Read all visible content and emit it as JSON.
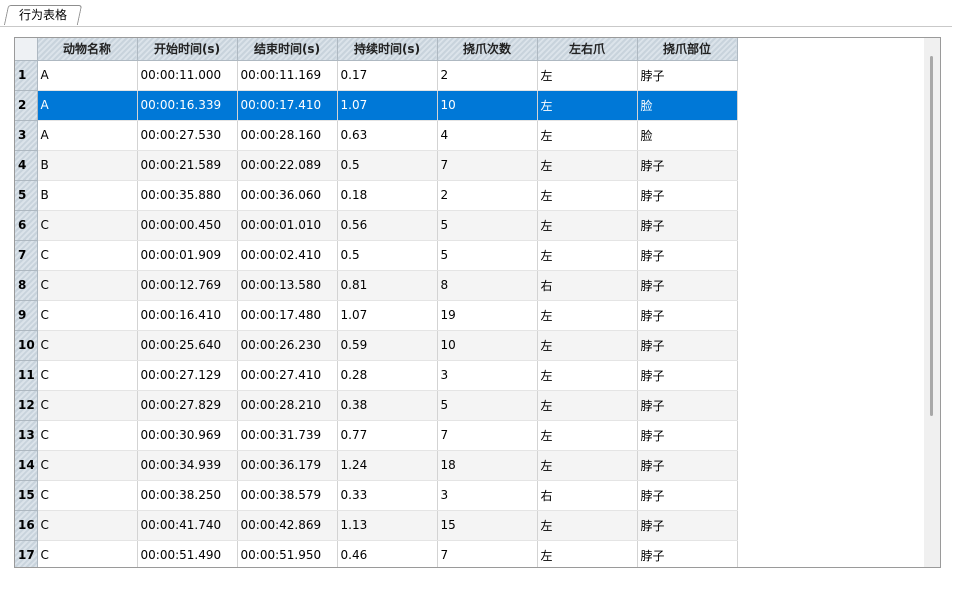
{
  "tab": {
    "label": "行为表格"
  },
  "table": {
    "columns": [
      "动物名称",
      "开始时间(s)",
      "结束时间(s)",
      "持续时间(s)",
      "挠爪次数",
      "左右爪",
      "挠爪部位"
    ],
    "selected_row": 2,
    "rows": [
      {
        "num": "1",
        "cells": [
          "A",
          "00:00:11.000",
          "00:00:11.169",
          "0.17",
          "2",
          "左",
          "脖子"
        ]
      },
      {
        "num": "2",
        "cells": [
          "A",
          "00:00:16.339",
          "00:00:17.410",
          "1.07",
          "10",
          "左",
          "脸"
        ]
      },
      {
        "num": "3",
        "cells": [
          "A",
          "00:00:27.530",
          "00:00:28.160",
          "0.63",
          "4",
          "左",
          "脸"
        ]
      },
      {
        "num": "4",
        "cells": [
          "B",
          "00:00:21.589",
          "00:00:22.089",
          "0.5",
          "7",
          "左",
          "脖子"
        ]
      },
      {
        "num": "5",
        "cells": [
          "B",
          "00:00:35.880",
          "00:00:36.060",
          "0.18",
          "2",
          "左",
          "脖子"
        ]
      },
      {
        "num": "6",
        "cells": [
          "C",
          "00:00:00.450",
          "00:00:01.010",
          "0.56",
          "5",
          "左",
          "脖子"
        ]
      },
      {
        "num": "7",
        "cells": [
          "C",
          "00:00:01.909",
          "00:00:02.410",
          "0.5",
          "5",
          "左",
          "脖子"
        ]
      },
      {
        "num": "8",
        "cells": [
          "C",
          "00:00:12.769",
          "00:00:13.580",
          "0.81",
          "8",
          "右",
          "脖子"
        ]
      },
      {
        "num": "9",
        "cells": [
          "C",
          "00:00:16.410",
          "00:00:17.480",
          "1.07",
          "19",
          "左",
          "脖子"
        ]
      },
      {
        "num": "10",
        "cells": [
          "C",
          "00:00:25.640",
          "00:00:26.230",
          "0.59",
          "10",
          "左",
          "脖子"
        ]
      },
      {
        "num": "11",
        "cells": [
          "C",
          "00:00:27.129",
          "00:00:27.410",
          "0.28",
          "3",
          "左",
          "脖子"
        ]
      },
      {
        "num": "12",
        "cells": [
          "C",
          "00:00:27.829",
          "00:00:28.210",
          "0.38",
          "5",
          "左",
          "脖子"
        ]
      },
      {
        "num": "13",
        "cells": [
          "C",
          "00:00:30.969",
          "00:00:31.739",
          "0.77",
          "7",
          "左",
          "脖子"
        ]
      },
      {
        "num": "14",
        "cells": [
          "C",
          "00:00:34.939",
          "00:00:36.179",
          "1.24",
          "18",
          "左",
          "脖子"
        ]
      },
      {
        "num": "15",
        "cells": [
          "C",
          "00:00:38.250",
          "00:00:38.579",
          "0.33",
          "3",
          "右",
          "脖子"
        ]
      },
      {
        "num": "16",
        "cells": [
          "C",
          "00:00:41.740",
          "00:00:42.869",
          "1.13",
          "15",
          "左",
          "脖子"
        ]
      },
      {
        "num": "17",
        "cells": [
          "C",
          "00:00:51.490",
          "00:00:51.950",
          "0.46",
          "7",
          "左",
          "脖子"
        ]
      }
    ]
  },
  "colors": {
    "selection": "#0078d7",
    "header_stripe_a": "#dbe3ea",
    "header_stripe_b": "#c8d3dc",
    "alt_row": "#f4f4f4"
  }
}
